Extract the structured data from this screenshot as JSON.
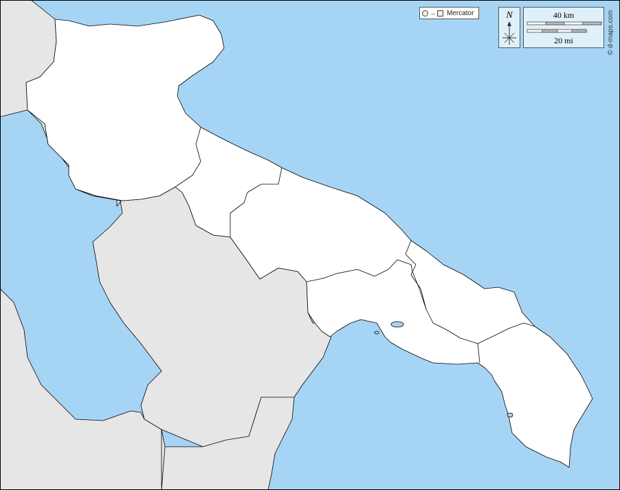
{
  "map": {
    "projection_label": "Mercator",
    "north_label": "N",
    "scale_km_label": "40 km",
    "scale_mi_label": "20 mi",
    "credit": "© d-maps.com",
    "colors": {
      "sea": "#a6d4f5",
      "region": "#ffffff",
      "neighbor": "#e6e6e6",
      "border": "#000000",
      "lake": "#a6d4f5"
    }
  }
}
